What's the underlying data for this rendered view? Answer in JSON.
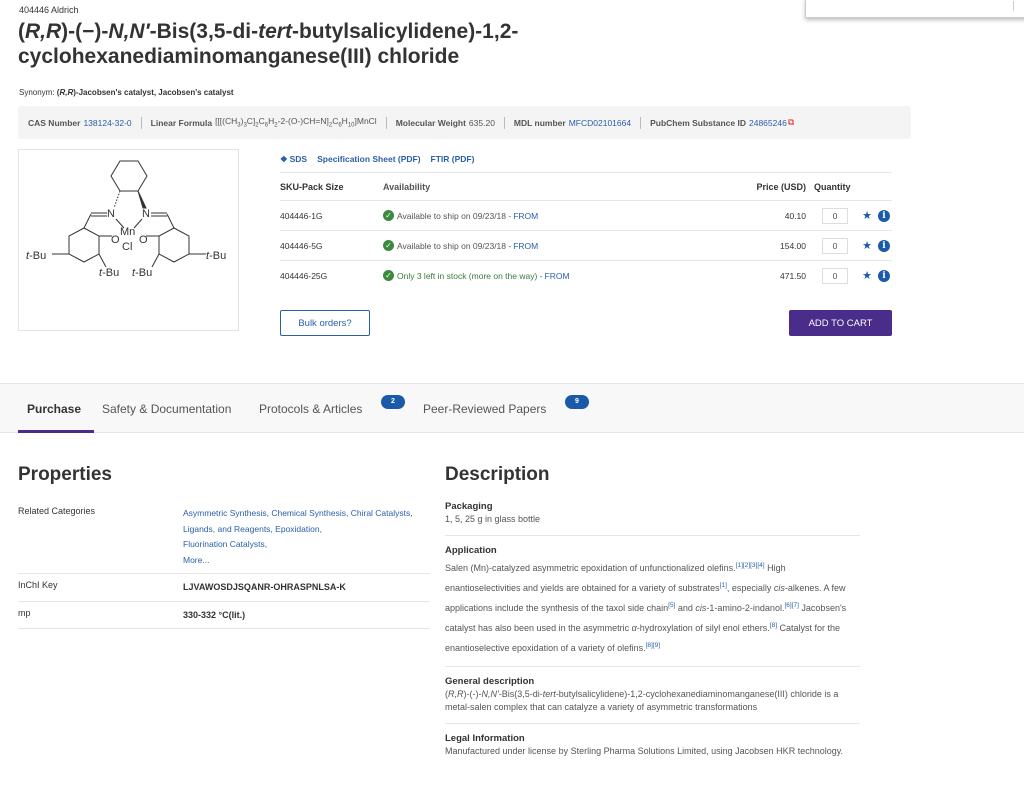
{
  "header": {
    "brand": "404446 Aldrich",
    "title_parts": [
      "(",
      "R,R",
      ")-(−)-",
      "N,N′",
      "-Bis(3,5-di-",
      "tert",
      "-butylsalicylidene)-1,2-cyclohexanediaminomanganese(III) chloride"
    ],
    "synonym_label": "Synonym: ",
    "synonym_italic": "R,R",
    "synonym_rest": ")-Jacobsen's catalyst, Jacobsen's catalyst"
  },
  "infobar": {
    "cas_label": "CAS Number",
    "cas_value": "138124-32-0",
    "formula_label": "Linear Formula",
    "formula_value": "[[[(CH3)3C]2C6H2-2-(O-)CH=N]2C6H10]MnCl",
    "mw_label": "Molecular Weight",
    "mw_value": "635.20",
    "mdl_label": "MDL number",
    "mdl_value": "MFCD02101664",
    "pubchem_label": "PubChem Substance ID",
    "pubchem_value": "24865246",
    "external_link_icon": "external-link-icon"
  },
  "structure": {
    "atoms": [
      "N",
      "N",
      "Mn",
      "O",
      "O",
      "Cl",
      "t-Bu",
      "t-Bu",
      "t-Bu",
      "t-Bu"
    ]
  },
  "doc_links": {
    "sds": "SDS",
    "spec_sheet": "Specification Sheet (PDF)",
    "ftir": "FTIR (PDF)"
  },
  "sku_table": {
    "headers": {
      "sku": "SKU-Pack Size",
      "availability": "Availability",
      "price": "Price (USD)",
      "quantity": "Quantity"
    },
    "rows": [
      {
        "sku": "404446-1G",
        "availability": "Available to ship on 09/23/18 - ",
        "from": "FROM",
        "price": "40.10",
        "qty": "0"
      },
      {
        "sku": "404446-5G",
        "availability": "Available to ship on 09/23/18 - ",
        "from": "FROM",
        "price": "154.00",
        "qty": "0"
      },
      {
        "sku": "404446-25G",
        "availability": "Only 3 left in stock (more on the way) - ",
        "from": "FROM",
        "price": "471.50",
        "qty": "0"
      }
    ]
  },
  "actions": {
    "bulk_orders": "Bulk orders?",
    "add_to_cart": "ADD TO CART"
  },
  "tabs": [
    {
      "label": "Purchase",
      "active": true
    },
    {
      "label": "Safety & Documentation"
    },
    {
      "label": "Protocols & Articles",
      "badge": "2"
    },
    {
      "label": "Peer-Reviewed Papers",
      "badge": "9"
    }
  ],
  "properties": {
    "title": "Properties",
    "related_label": "Related Categories",
    "related_links": [
      "Asymmetric Synthesis,",
      "Chemical Synthesis,",
      "Chiral Catalysts, Ligands, and Reagents,",
      "Epoxidation,",
      "Fluorination Catalysts,"
    ],
    "more": "More...",
    "inchi_label": "InChI Key",
    "inchi_value": "LJVAWOSDJSQANR-OHRASPNLSA-K",
    "mp_label": "mp",
    "mp_value": "330-332 °C(lit.)"
  },
  "description": {
    "title": "Description",
    "packaging_title": "Packaging",
    "packaging_body": "1, 5, 25 g in glass bottle",
    "application_title": "Application",
    "application": {
      "t1": "Salen (Mn)-catalyzed asymmetric epoxidation of unfunctionalized olefins.",
      "r1": "[1][2][3][4]",
      "t2": " High enantioselectivities and yields are obtained for a variety of substrates",
      "r2": "[1]",
      "t3": ", especially ",
      "i1": "cis",
      "t4": "-alkenes. A few applications include the synthesis of the taxol side chain",
      "r3": "[5]",
      "t5": " and ",
      "i2": "cis",
      "t6": "-1-amino-2-indanol.",
      "r4": "[6][7]",
      "t7": " Jacobsen's catalyst has also been used in the asymmetric ",
      "i3": "α",
      "t8": "-hydroxylation of silyl enol ethers.",
      "r5": "[8]",
      "t9": " Catalyst for the enantioselective epoxidation of a variety of olefins.",
      "r6": "[8][9]"
    },
    "general_title": "General description",
    "general": {
      "p1": "(",
      "i1": "R,R",
      "p2": ")-(-)-",
      "i2": "N,N'",
      "p3": "-Bis(3,5-di-",
      "i3": "tert",
      "p4": "-butylsalicylidene)-1,2-cyclohexanediaminomanganese(III) chloride is a metal-salen complex that can catalyze a variety of asymmetric transformations"
    },
    "legal_title": "Legal Information",
    "legal_body": "Manufactured under license by Sterling Pharma Solutions Limited, using Jacobsen HKR technology."
  }
}
